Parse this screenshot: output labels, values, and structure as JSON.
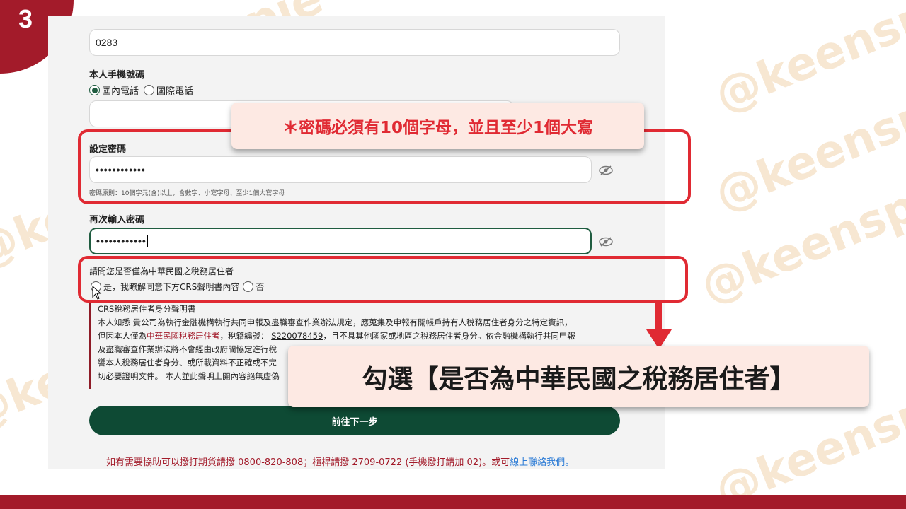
{
  "step": "3",
  "watermark": "@keenspie",
  "form": {
    "prev_field_value": "0283",
    "phone_label": "本人手機號碼",
    "phone_options": [
      "國內電話",
      "國際電話"
    ],
    "password_label": "設定密碼",
    "password_dots": "••••••••••••",
    "password_rule": "密碼原則：10個字元(含)以上，含數字、小寫字母、至少1個大寫字母",
    "confirm_label": "再次輸入密碼",
    "confirm_dots": "••••••••••••",
    "tax_question": "請問您是否僅為中華民國之稅務居住者",
    "tax_yes": "是，我瞭解同意下方CRS聲明書內容",
    "tax_no": "否",
    "declaration": {
      "title": "CRS稅務居住者身分聲明書",
      "line1": "本人知悉 貴公司為執行金融機構執行共同申報及盡職審查作業辦法規定，應蒐集及申報有關帳戶持有人稅務居住者身分之特定資訊，",
      "line2_a": "但因本人僅為",
      "line2_hl": "中華民國稅務居住者",
      "line2_b": "，稅籍編號：",
      "line2_id": "S220078459",
      "line2_c": "，且不具其他國家或地區之稅務居住者身分。依金融機構執行共同申報",
      "line3": "及盡職審查作業辦法將不會經由政府間協定進行稅",
      "line4": "響本人稅務居住者身分、或所載資料不正確或不完",
      "line5": "切必要證明文件。 本人並此聲明上開內容絕無虛偽"
    },
    "submit_label": "前往下一步",
    "help_text": "如有需要協助可以撥打期貨請撥 0800-820-808；櫃桿請撥 2709-0722 (手機撥打請加 02)。或可",
    "help_link": "線上聯絡我們",
    "help_end": "。"
  },
  "callouts": {
    "password_note": "＊密碼必須有10個字母，並且至少1個大寫",
    "tax_note": "勾選【是否為中華民國之稅務居住者】"
  },
  "colors": {
    "brand_red": "#a31b2a",
    "highlight_red": "#e02a33",
    "button_green": "#0e4a34",
    "callout_bg": "#fde9e3"
  }
}
